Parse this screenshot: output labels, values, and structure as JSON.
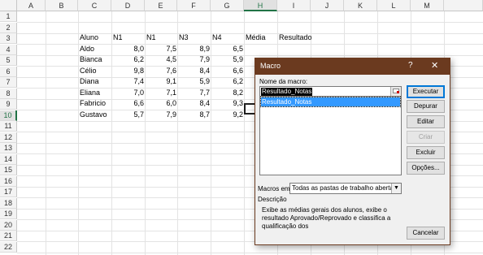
{
  "sheet": {
    "columns": [
      "A",
      "B",
      "C",
      "D",
      "E",
      "F",
      "G",
      "H",
      "I",
      "J",
      "K",
      "L",
      "M"
    ],
    "rows": [
      "1",
      "2",
      "3",
      "4",
      "5",
      "6",
      "7",
      "8",
      "9",
      "10",
      "11",
      "12",
      "13",
      "14",
      "15",
      "16",
      "17",
      "18",
      "19",
      "20",
      "21",
      "22"
    ],
    "header_row": {
      "aluno": "Aluno",
      "n1a": "N1",
      "n1b": "N1",
      "n3": "N3",
      "n4": "N4",
      "media": "Média",
      "resultado": "Resultado"
    },
    "students": [
      {
        "name": "Aldo",
        "d": "8,0",
        "e": "7,5",
        "f": "8,9",
        "g": "6,5"
      },
      {
        "name": "Bianca",
        "d": "6,2",
        "e": "4,5",
        "f": "7,9",
        "g": "5,9"
      },
      {
        "name": "Célio",
        "d": "9,8",
        "e": "7,6",
        "f": "8,4",
        "g": "6,6"
      },
      {
        "name": "Diana",
        "d": "7,4",
        "e": "9,1",
        "f": "5,9",
        "g": "6,2"
      },
      {
        "name": "Eliana",
        "d": "7,0",
        "e": "7,1",
        "f": "7,7",
        "g": "8,2"
      },
      {
        "name": "Fabricio",
        "d": "6,6",
        "e": "6,0",
        "f": "8,4",
        "g": "9,3"
      },
      {
        "name": "Gustavo",
        "d": "5,7",
        "e": "7,9",
        "f": "8,7",
        "g": "9,2"
      }
    ],
    "selected_column": "H",
    "selected_row": "10"
  },
  "dialog": {
    "title": "Macro",
    "help_glyph": "?",
    "close_glyph": "✕",
    "name_label": "Nome da macro:",
    "macro_name": "Resultado_Notas",
    "macros": [
      "Resultado_Notas"
    ],
    "buttons": {
      "run": "Executar",
      "step": "Depurar",
      "edit": "Editar",
      "create": "Criar",
      "delete": "Excluir",
      "options": "Opções...",
      "cancel": "Cancelar"
    },
    "macros_in_label": "Macros em:",
    "macros_in_value": "Todas as pastas de trabalho abertas",
    "description_label": "Descrição",
    "description": "Exibe as médias gerais dos alunos, exibe o resultado Aprovado/Reprovado e classifica a qualificação dos",
    "title_color": "#6b3a1f"
  }
}
